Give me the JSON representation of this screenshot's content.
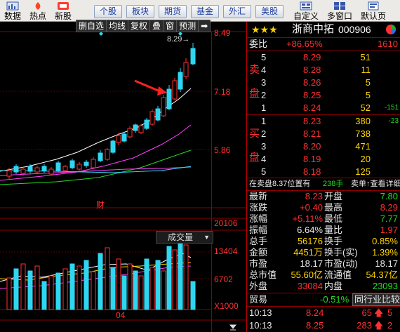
{
  "toolbar": {
    "left": [
      {
        "label": "数据",
        "icon": "data-icon"
      },
      {
        "label": "热点",
        "icon": "hotspot-icon"
      },
      {
        "label": "新股",
        "icon": "new-stock-icon"
      }
    ],
    "tabs": [
      "个股",
      "板块",
      "期货",
      "基金",
      "外汇",
      "美股"
    ],
    "right": [
      {
        "label": "自定义",
        "icon": "custom-icon"
      },
      {
        "label": "多窗口",
        "icon": "multi-window-icon"
      },
      {
        "label": "默认页",
        "icon": "default-page-icon"
      }
    ]
  },
  "chart_toolbar": [
    "删自选",
    "均线",
    "复权",
    "叠",
    "窗",
    "预测",
    "➡"
  ],
  "price_axis": {
    "top": "8.49",
    "mid": "7.18",
    "low": "5.86",
    "peak_label": "8.29"
  },
  "fin_marker": "财",
  "volume": {
    "header": "成交量",
    "axis": [
      "20106",
      "13404",
      "6702",
      "X1000"
    ],
    "date_label": "04"
  },
  "stock": {
    "name": "浙商中拓",
    "code": "000906",
    "stars": "★★★"
  },
  "commission": {
    "label": "委比",
    "pct": "+86.65%",
    "diff": "1610"
  },
  "sell": {
    "side_label": [
      "卖",
      "盘"
    ],
    "rows": [
      {
        "n": "5",
        "price": "8.29",
        "vol": "51",
        "chg": ""
      },
      {
        "n": "4",
        "price": "8.28",
        "vol": "11",
        "chg": ""
      },
      {
        "n": "3",
        "price": "8.26",
        "vol": "5",
        "chg": ""
      },
      {
        "n": "2",
        "price": "8.25",
        "vol": "5",
        "chg": ""
      },
      {
        "n": "1",
        "price": "8.24",
        "vol": "52",
        "chg": "-151"
      }
    ]
  },
  "buy": {
    "side_label": [
      "买",
      "盘"
    ],
    "rows": [
      {
        "n": "1",
        "price": "8.23",
        "vol": "380",
        "chg": "-23"
      },
      {
        "n": "2",
        "price": "8.21",
        "vol": "738",
        "chg": ""
      },
      {
        "n": "3",
        "price": "8.20",
        "vol": "471",
        "chg": ""
      },
      {
        "n": "4",
        "price": "8.19",
        "vol": "20",
        "chg": ""
      },
      {
        "n": "5",
        "price": "8.18",
        "vol": "125",
        "chg": ""
      }
    ]
  },
  "notice": {
    "text": "在卖盘8.37位置有",
    "qty": "238手",
    "action": "卖单↑查看详细"
  },
  "stats": [
    {
      "l1": "最新",
      "v1": "8.23",
      "c1": "red",
      "l2": "开盘",
      "v2": "7.80",
      "c2": "green"
    },
    {
      "l1": "涨跌",
      "v1": "+0.40",
      "c1": "red",
      "l2": "最高",
      "v2": "8.29",
      "c2": "red"
    },
    {
      "l1": "涨幅",
      "v1": "+5.11%",
      "c1": "red",
      "l2": "最低",
      "v2": "7.77",
      "c2": "green"
    },
    {
      "l1": "振幅",
      "v1": "6.64%",
      "c1": "white",
      "l2": "量比",
      "v2": "1.97",
      "c2": "red"
    },
    {
      "l1": "总手",
      "v1": "56176",
      "c1": "yellow",
      "l2": "换手",
      "v2": "0.85%",
      "c2": "yellow"
    },
    {
      "l1": "金额",
      "v1": "4451万",
      "c1": "yellow",
      "l2": "换手(实)",
      "v2": "1.39%",
      "c2": "yellow"
    },
    {
      "l1": "市盈",
      "v1": "18.17",
      "c1": "white",
      "l2": "市盈(动)",
      "v2": "18.17",
      "c2": "white"
    },
    {
      "l1": "总市值",
      "v1": "55.60亿",
      "c1": "yellow",
      "l2": "流通值",
      "v2": "54.37亿",
      "c2": "yellow"
    },
    {
      "l1": "外盘",
      "v1": "33084",
      "c1": "red",
      "l2": "内盘",
      "v2": "23093",
      "c2": "green"
    }
  ],
  "industry": {
    "label": "贸易",
    "pct": "-0.51%",
    "compare": "同行业比较"
  },
  "ticks": [
    {
      "time": "10:13",
      "price": "8.24",
      "vol": "65",
      "flag": "5"
    },
    {
      "time": "10:13",
      "price": "8.25",
      "vol": "283",
      "flag": "2"
    }
  ],
  "colors": {
    "up": "#ff3030",
    "down": "#2fd6f0",
    "ma5": "#ffffff",
    "ma10": "#ffd400",
    "ma20": "#ff40ff",
    "ma60": "#22dd22",
    "ma120": "#2fd6f0",
    "grid": "#8b0000"
  }
}
